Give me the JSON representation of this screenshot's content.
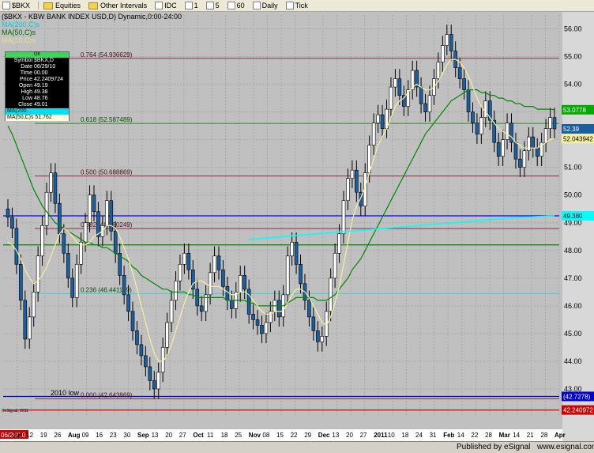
{
  "toolbar": {
    "symbol": "$BKX",
    "items": [
      "Equities",
      "Other Intervals",
      "IDC",
      "1",
      "5",
      "60",
      "Daily",
      "Tick"
    ]
  },
  "legend": {
    "title": "($BKX - KBW BANK INDEX USD,D) Dynamic,0:00-24:00",
    "ma_cyan": "MA(200,C)s",
    "ma_green": "MA(50,C)s",
    "ma_yellow": "MA(10,C)s"
  },
  "data_panel": {
    "header": "OK",
    "rows": [
      {
        "k": "Symbol",
        "v": "$BKX,D"
      },
      {
        "k": "Date",
        "v": "06/29/10"
      },
      {
        "k": "Time",
        "v": "00.00"
      },
      {
        "k": "Price",
        "v": "42.2409724"
      },
      {
        "k": "Open",
        "v": "49.19"
      },
      {
        "k": "High",
        "v": "49.38"
      },
      {
        "k": "Low",
        "v": "48.76"
      },
      {
        "k": "Close",
        "v": "49.01"
      }
    ],
    "ma_a": "MA(200...",
    "ma_b": "MA(50,C)s 51.762"
  },
  "annotations": {
    "low_label": "2010 low",
    "fib_labels": [
      "0.764 (54.936629)",
      "0.618 (52.587489)",
      "0.500 (50.688869)",
      "0.382 (48.790249)",
      "0.236 (46.441109)",
      "0.000 (42.643869)"
    ]
  },
  "footer": {
    "credit": "Published by eSignal",
    "url": "www.esignal.com",
    "corner": "©eSignal, 2011"
  },
  "colors": {
    "background": "#c0c0c0",
    "grid": "#a8a8a8",
    "up": "#000000",
    "down": "#1a5fa0",
    "ma200": "#00ffff",
    "ma50": "#008800",
    "ma10": "#f5f0a0",
    "fib": "#8b2f4a"
  },
  "chart_data": {
    "type": "candlestick",
    "title": "$BKX - KBW BANK INDEX USD,D",
    "ylim": [
      42.0,
      56.5
    ],
    "yticks": [
      "56.00",
      "55.00",
      "54.00",
      "53.00",
      "52.00",
      "51.00",
      "50.00",
      "49.00",
      "48.00",
      "47.00",
      "46.00",
      "45.00",
      "44.00",
      "43.00"
    ],
    "xticks": [
      "06/28/10",
      "Jul",
      "12",
      "19",
      "26",
      "Aug",
      "09",
      "16",
      "23",
      "30",
      "Sep",
      "13",
      "20",
      "27",
      "Oct",
      "11",
      "18",
      "25",
      "Nov",
      "08",
      "15",
      "22",
      "29",
      "Dec",
      "13",
      "20",
      "27",
      "2011",
      "10",
      "18",
      "24",
      "31",
      "Feb",
      "14",
      "22",
      "28",
      "Mar",
      "14",
      "21",
      "28",
      "Apr"
    ],
    "price_labels": [
      {
        "text": "53.0778",
        "value": 53.08,
        "color": "#00aa00"
      },
      {
        "text": "52.39",
        "value": 52.39,
        "color": "#1a5fa0"
      },
      {
        "text": "52.043942",
        "value": 52.04,
        "color": "#f5f0a0"
      },
      {
        "text": "49.380",
        "value": 49.25,
        "color": "#00ffff"
      },
      {
        "text": "(42.7278)",
        "value": 42.73,
        "color": "#0000cc"
      },
      {
        "text": "42.240972",
        "value": 42.24,
        "color": "#cc0000"
      }
    ],
    "fib_levels": [
      {
        "ratio": "0.764",
        "value": 54.936629
      },
      {
        "ratio": "0.618",
        "value": 52.587489
      },
      {
        "ratio": "0.500",
        "value": 50.688869
      },
      {
        "ratio": "0.382",
        "value": 48.790249
      },
      {
        "ratio": "0.236",
        "value": 46.441109
      },
      {
        "ratio": "0.000",
        "value": 42.643869
      }
    ],
    "hlines": [
      {
        "value": 49.25,
        "color": "#0000ff"
      },
      {
        "value": 48.2,
        "color": "#008800"
      },
      {
        "value": 42.7278,
        "color": "#0000cc"
      },
      {
        "value": 42.24,
        "color": "#cc0000"
      }
    ],
    "closes": [
      49.2,
      48.8,
      47.5,
      46.2,
      44.8,
      45.6,
      46.5,
      47.8,
      48.9,
      50.1,
      50.8,
      49.7,
      48.6,
      47.9,
      47.0,
      46.3,
      47.5,
      48.3,
      49.0,
      50.0,
      49.4,
      48.5,
      48.9,
      49.8,
      48.7,
      47.9,
      47.1,
      46.4,
      45.8,
      45.1,
      44.6,
      44.2,
      43.8,
      43.3,
      43.0,
      43.6,
      44.5,
      45.4,
      46.2,
      46.9,
      47.5,
      47.9,
      47.3,
      46.6,
      46.0,
      45.8,
      46.4,
      47.2,
      47.8,
      47.3,
      46.7,
      46.2,
      45.9,
      46.5,
      47.1,
      46.6,
      45.7,
      45.5,
      45.3,
      45.0,
      45.4,
      45.8,
      46.2,
      45.6,
      46.4,
      47.8,
      48.3,
      47.5,
      46.8,
      46.2,
      45.6,
      45.1,
      44.7,
      44.9,
      45.8,
      47.0,
      47.9,
      48.6,
      49.8,
      50.6,
      50.9,
      50.1,
      49.6,
      50.8,
      51.8,
      52.6,
      52.9,
      52.4,
      53.1,
      53.9,
      54.2,
      53.6,
      53.2,
      53.8,
      54.5,
      53.9,
      53.3,
      53.0,
      53.6,
      54.2,
      54.8,
      55.4,
      55.8,
      55.2,
      54.6,
      54.2,
      53.8,
      53.0,
      52.6,
      52.2,
      52.8,
      53.4,
      52.7,
      51.9,
      51.4,
      52.0,
      52.6,
      51.9,
      51.3,
      51.0,
      51.6,
      52.1,
      51.7,
      51.4,
      51.9,
      52.4,
      52.8,
      52.39
    ],
    "ma10": [
      48.3,
      48.2,
      48.0,
      47.7,
      47.3,
      47.0,
      46.8,
      46.9,
      47.1,
      47.4,
      47.8,
      48.2,
      48.6,
      48.8,
      48.7,
      48.5,
      48.3,
      48.2,
      48.2,
      48.3,
      48.5,
      48.6,
      48.7,
      48.9,
      48.9,
      48.8,
      48.5,
      48.1,
      47.7,
      47.2,
      46.6,
      46.0,
      45.4,
      44.8,
      44.3,
      44.0,
      44.0,
      44.2,
      44.6,
      45.1,
      45.6,
      46.1,
      46.5,
      46.8,
      46.9,
      46.9,
      46.8,
      46.7,
      46.7,
      46.7,
      46.6,
      46.5,
      46.4,
      46.4,
      46.5,
      46.5,
      46.4,
      46.2,
      46.0,
      45.8,
      45.7,
      45.7,
      45.8,
      45.8,
      45.8,
      46.1,
      46.4,
      46.6,
      46.6,
      46.5,
      46.3,
      46.0,
      45.7,
      45.4,
      45.3,
      45.6,
      46.1,
      46.7,
      47.5,
      48.3,
      49.1,
      49.6,
      49.9,
      50.3,
      50.8,
      51.3,
      51.8,
      52.1,
      52.4,
      52.8,
      53.2,
      53.4,
      53.5,
      53.7,
      53.9,
      54.0,
      53.9,
      53.8,
      53.8,
      53.9,
      54.1,
      54.4,
      54.7,
      54.9,
      54.9,
      54.8,
      54.6,
      54.3,
      53.9,
      53.5,
      53.2,
      53.0,
      52.8,
      52.6,
      52.4,
      52.3,
      52.2,
      52.1,
      51.9,
      51.8,
      51.7,
      51.7,
      51.7,
      51.7,
      51.8,
      51.9,
      52.0,
      52.04
    ],
    "ma50": [
      52.5,
      52.2,
      51.8,
      51.4,
      51.0,
      50.6,
      50.2,
      49.9,
      49.6,
      49.4,
      49.2,
      49.0,
      48.9,
      48.8,
      48.7,
      48.6,
      48.5,
      48.4,
      48.3,
      48.3,
      48.2,
      48.2,
      48.1,
      48.1,
      48.0,
      47.9,
      47.8,
      47.7,
      47.6,
      47.4,
      47.3,
      47.1,
      47.0,
      46.9,
      46.8,
      46.7,
      46.6,
      46.6,
      46.5,
      46.5,
      46.5,
      46.5,
      46.4,
      46.4,
      46.3,
      46.3,
      46.3,
      46.3,
      46.3,
      46.3,
      46.3,
      46.2,
      46.2,
      46.2,
      46.2,
      46.2,
      46.1,
      46.1,
      46.0,
      46.0,
      46.0,
      46.0,
      46.0,
      46.0,
      46.0,
      46.1,
      46.2,
      46.3,
      46.3,
      46.3,
      46.3,
      46.3,
      46.2,
      46.2,
      46.2,
      46.3,
      46.4,
      46.6,
      46.8,
      47.0,
      47.3,
      47.5,
      47.7,
      48.0,
      48.3,
      48.6,
      48.9,
      49.2,
      49.5,
      49.8,
      50.1,
      50.4,
      50.7,
      51.0,
      51.3,
      51.6,
      51.9,
      52.2,
      52.4,
      52.6,
      52.8,
      53.0,
      53.2,
      53.4,
      53.5,
      53.6,
      53.7,
      53.8,
      53.8,
      53.8,
      53.7,
      53.7,
      53.6,
      53.6,
      53.5,
      53.5,
      53.4,
      53.4,
      53.3,
      53.3,
      53.2,
      53.2,
      53.2,
      53.1,
      53.1,
      53.1,
      53.1,
      53.08
    ],
    "ma200": [
      48.4,
      48.5,
      48.6,
      48.7,
      48.8,
      48.9,
      49.0,
      49.1,
      49.2,
      49.25
    ]
  }
}
